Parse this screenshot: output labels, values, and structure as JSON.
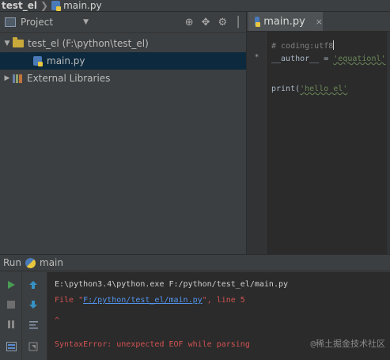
{
  "breadcrumb": {
    "root": "test_el",
    "separator": "❯",
    "file": "main.py"
  },
  "project_panel": {
    "title": "Project",
    "dropdown_glyph": "▼",
    "tools": [
      "⊕",
      "✥",
      "⚙",
      "│"
    ],
    "tree": [
      {
        "arrow": "▼",
        "label": "test_el (F:\\python\\test_el)",
        "type": "folder"
      },
      {
        "arrow": "",
        "label": "main.py",
        "type": "file",
        "selected": true
      },
      {
        "arrow": "▶",
        "label": "External Libraries",
        "type": "library"
      }
    ]
  },
  "editor": {
    "tab_label": "main.py",
    "tab_close": "×",
    "lines": {
      "line1": "# coding:utf8",
      "line2_pre": "__author__ = ",
      "line2_str": "'equationl'",
      "line3_pre": "print(",
      "line3_str": "'hello el'",
      "line3_post": ""
    },
    "gutter_marker": "*"
  },
  "run_panel": {
    "label": "Run",
    "config_name": "main",
    "console": {
      "line1": "E:\\python3.4\\python.exe F:/python/test_el/main.py",
      "line2_pre": "  File \"",
      "line2_link": "F:/python/test_el/main.py",
      "line2_post": "\", line 5",
      "line3": "          ^",
      "line4": "SyntaxError: unexpected EOF while parsing"
    },
    "watermark": "@稀土掘金技术社区"
  },
  "colors": {
    "run_green": "#499c54",
    "arrow_blue": "#3592c4",
    "error_red": "#d25252"
  }
}
